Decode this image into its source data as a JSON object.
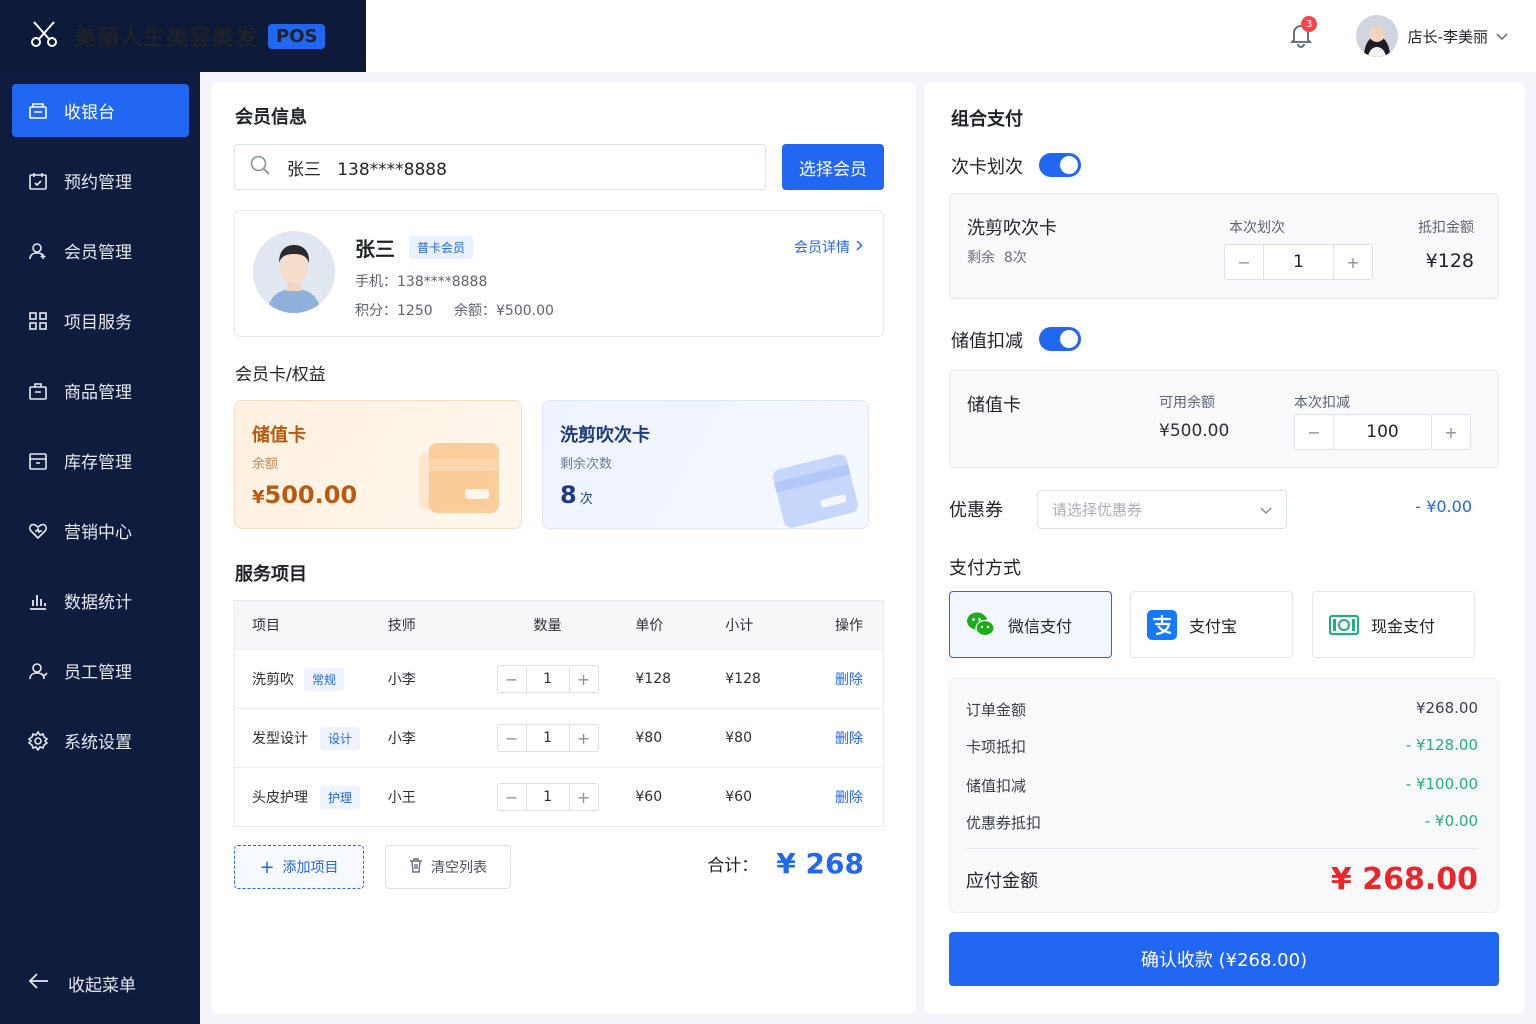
{
  "brand": {
    "title": "美丽人生美容美发",
    "badge": "POS"
  },
  "nav": {
    "items": [
      {
        "label": "收银台",
        "icon": "register-icon",
        "active": true
      },
      {
        "label": "预约管理",
        "icon": "calendar-icon"
      },
      {
        "label": "会员管理",
        "icon": "user-icon"
      },
      {
        "label": "项目服务",
        "icon": "grid-icon"
      },
      {
        "label": "商品管理",
        "icon": "bag-icon"
      },
      {
        "label": "库存管理",
        "icon": "box-icon"
      },
      {
        "label": "营销中心",
        "icon": "heart-icon"
      },
      {
        "label": "数据统计",
        "icon": "bar-chart-icon"
      },
      {
        "label": "员工管理",
        "icon": "staff-icon"
      },
      {
        "label": "系统设置",
        "icon": "gear-icon"
      }
    ],
    "collapse_label": "收起菜单"
  },
  "topbar": {
    "notification_count": "3",
    "user_name": "店长-李美丽"
  },
  "member": {
    "section_title": "会员信息",
    "search_value": "张三   138****8888",
    "select_button": "选择会员",
    "name": "张三",
    "level": "普卡会员",
    "detail_link": "会员详情",
    "phone": "手机：138****8888",
    "points": "积分：1250",
    "balance": "余额：¥500.00"
  },
  "cards": {
    "section_title": "会员卡/权益",
    "stored": {
      "title": "储值卡",
      "label": "余额",
      "currency": "¥",
      "value": "500.00"
    },
    "times": {
      "title": "洗剪吹次卡",
      "label": "剩余次数",
      "value": "8",
      "unit": "次"
    }
  },
  "services": {
    "section_title": "服务项目",
    "headers": [
      "项目",
      "技师",
      "数量",
      "单价",
      "小计",
      "操作"
    ],
    "rows": [
      {
        "name": "洗剪吹",
        "tag": "常规",
        "tech": "小李",
        "qty": "1",
        "price": "¥128",
        "subtotal": "¥128",
        "action": "删除"
      },
      {
        "name": "发型设计",
        "tag": "设计",
        "tech": "小李",
        "qty": "1",
        "price": "¥80",
        "subtotal": "¥80",
        "action": "删除"
      },
      {
        "name": "头皮护理",
        "tag": "护理",
        "tech": "小王",
        "qty": "1",
        "price": "¥60",
        "subtotal": "¥60",
        "action": "删除"
      }
    ],
    "add_button": "添加项目",
    "clear_button": "清空列表",
    "total_label": "合计：",
    "total_value": "¥ 268"
  },
  "payment": {
    "section_title": "组合支付",
    "times_card": {
      "toggle_label": "次卡划次",
      "enabled": true,
      "name": "洗剪吹次卡",
      "remaining": "剩余  8次",
      "qty_label": "本次划次",
      "qty": "1",
      "deduct_label": "抵扣金额",
      "deduct_value": "¥128"
    },
    "stored_value": {
      "toggle_label": "储值扣减",
      "enabled": true,
      "name": "储值卡",
      "available_label": "可用余额",
      "available_value": "¥500.00",
      "deduct_label": "本次扣减",
      "deduct_value": "100"
    },
    "coupon": {
      "label": "优惠券",
      "placeholder": "请选择优惠券",
      "amount": "- ¥0.00"
    },
    "methods_title": "支付方式",
    "methods": [
      {
        "label": "微信支付",
        "icon": "wechat-icon",
        "selected": true
      },
      {
        "label": "支付宝",
        "icon": "alipay-icon",
        "selected": false
      },
      {
        "label": "现金支付",
        "icon": "cash-icon",
        "selected": false
      }
    ],
    "summary": {
      "order_label": "订单金额",
      "order_value": "¥268.00",
      "card_label": "卡项抵扣",
      "card_value": "- ¥128.00",
      "stored_label": "储值扣减",
      "stored_value": "- ¥100.00",
      "coupon_label": "优惠券抵扣",
      "coupon_value": "- ¥0.00",
      "payable_label": "应付金额",
      "payable_value": "¥ 268.00"
    },
    "confirm_button": "确认收款 (¥268.00)"
  },
  "colors": {
    "primary": "#2267f2",
    "sidebar": "#0f1c3d",
    "danger": "#e8262b",
    "success": "#22b07a",
    "warm": "#b85a10"
  }
}
